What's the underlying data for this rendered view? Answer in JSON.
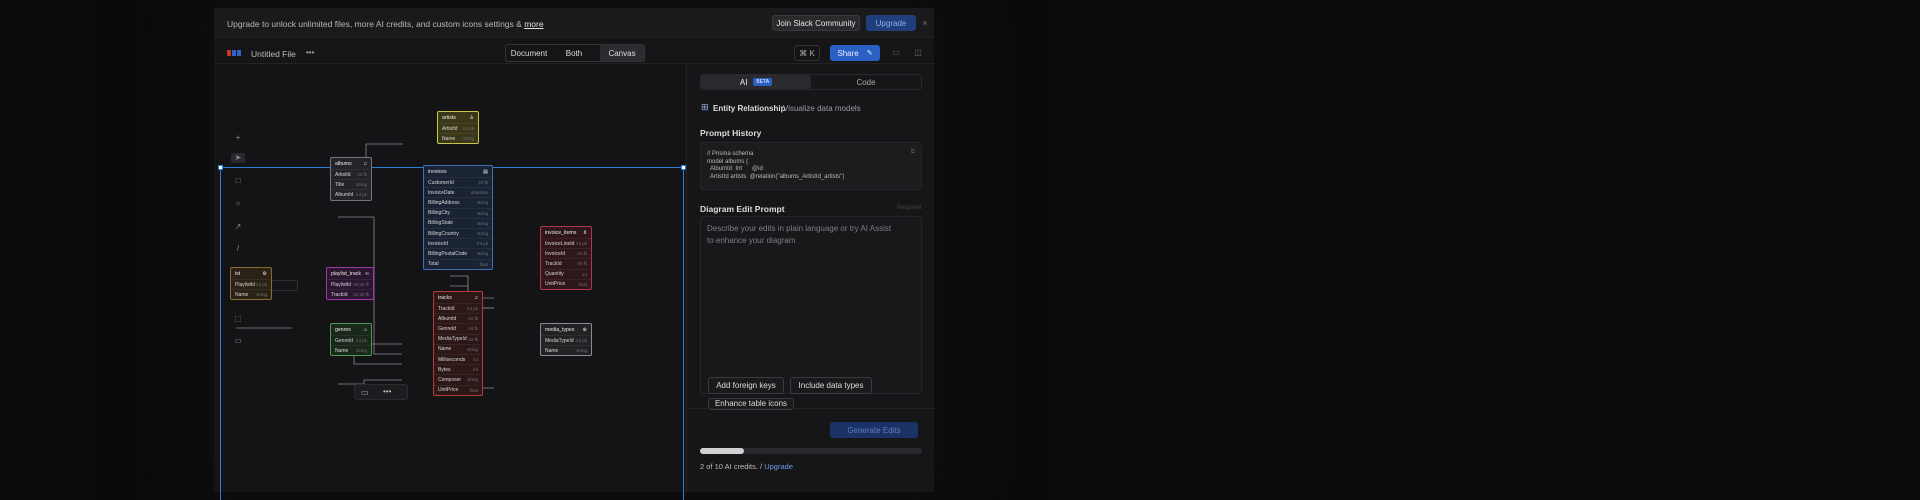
{
  "banner": {
    "message": "Upgrade to unlock unlimited files, more AI credits, and custom icons settings &",
    "link": "more",
    "join": "Join Slack Community",
    "upgrade": "Upgrade"
  },
  "toolbar": {
    "file_name": "Untitled File",
    "more": "•••",
    "views": [
      "Document",
      "Both",
      "Canvas"
    ],
    "shortcut": "⌘ K",
    "share": "Share"
  },
  "canvas": {
    "note_label": "Untitled ERD",
    "tables": [
      {
        "id": "artists",
        "name": "artists",
        "icon": "user-icon",
        "color": "#c8c64a",
        "fill": "#3a3818",
        "rows": [
          [
            "ArtistId",
            "int pk"
          ],
          [
            "Name",
            "string"
          ]
        ]
      },
      {
        "id": "albums",
        "name": "albums",
        "icon": "music-icon",
        "color": "#6f7682",
        "fill": "#222428",
        "rows": [
          [
            "ArtistId",
            "int fk"
          ],
          [
            "Title",
            "string"
          ],
          [
            "AlbumId",
            "int pk"
          ]
        ]
      },
      {
        "id": "invoices",
        "name": "invoices",
        "icon": "document-icon",
        "color": "#3f6fb8",
        "fill": "#1a2333",
        "rows": [
          [
            "CustomerId",
            "int fk"
          ],
          [
            "InvoiceDate",
            "datetime"
          ],
          [
            "BillingAddress",
            "string"
          ],
          [
            "BillingCity",
            "string"
          ],
          [
            "BillingState",
            "string"
          ],
          [
            "BillingCountry",
            "string"
          ],
          [
            "InvoiceId",
            "int pk"
          ],
          [
            "BillingPostalCode",
            "string"
          ],
          [
            "Total",
            "float"
          ]
        ]
      },
      {
        "id": "invoice_items",
        "name": "invoice_items",
        "icon": "cart-icon",
        "color": "#b3374a",
        "fill": "#2e161b",
        "rows": [
          [
            "InvoiceLineId",
            "int pk"
          ],
          [
            "InvoiceId",
            "int fk"
          ],
          [
            "TrackId",
            "int fk"
          ],
          [
            "Quantity",
            "int"
          ],
          [
            "UnitPrice",
            "float"
          ]
        ]
      },
      {
        "id": "ist",
        "name": "ist",
        "icon": "gear-icon",
        "color": "#8a6b32",
        "fill": "#2a2216",
        "rows": [
          [
            "PlaylistId",
            "int pk"
          ],
          [
            "Name",
            "string"
          ]
        ]
      },
      {
        "id": "playlist_track",
        "name": "playlist_track",
        "icon": "link-icon",
        "color": "#a036a8",
        "fill": "#2b1630",
        "rows": [
          [
            "PlaylistId",
            "int pk fk"
          ],
          [
            "TrackId",
            "int pk fk"
          ]
        ]
      },
      {
        "id": "tracks",
        "name": "tracks",
        "icon": "music-icon",
        "color": "#b33b3b",
        "fill": "#2d1717",
        "rows": [
          [
            "TrackId",
            "int pk"
          ],
          [
            "AlbumId",
            "int fk"
          ],
          [
            "GenreId",
            "int fk"
          ],
          [
            "MediaTypeId",
            "int fk"
          ],
          [
            "Name",
            "string"
          ],
          [
            "Milliseconds",
            "int"
          ],
          [
            "Bytes",
            "int"
          ],
          [
            "Composer",
            "string"
          ],
          [
            "UnitPrice",
            "float"
          ]
        ]
      },
      {
        "id": "genres",
        "name": "genres",
        "icon": "tag-icon",
        "color": "#4f9a4f",
        "fill": "#19281a",
        "rows": [
          [
            "GenreId",
            "int pk"
          ],
          [
            "Name",
            "string"
          ]
        ]
      },
      {
        "id": "media_types",
        "name": "media_types",
        "icon": "plus-circle-icon",
        "color": "#8a8a90",
        "fill": "#222225",
        "rows": [
          [
            "MediaTypeId",
            "int pk"
          ],
          [
            "Name",
            "string"
          ]
        ]
      }
    ]
  },
  "panel": {
    "tabs": [
      "AI",
      "Code"
    ],
    "beta": "BETA",
    "entity_title": "Entity Relationship",
    "entity_sub": "Visualize data models",
    "prompt_history": "Prompt History",
    "code_lines": [
      "// Prisma schema",
      "",
      "model albums {",
      "  AlbumId  Int      @id",
      "  ArtistId artists  @relation(\"albums_ArtistId_artists\")"
    ],
    "edit_title": "Diagram Edit Prompt",
    "required": "Required",
    "placeholder": "Describe your edits in plain language or try AI Assist to enhance your diagram",
    "chips": [
      "Add foreign keys",
      "Include data types",
      "Enhance table icons"
    ],
    "generate": "Generate Edits",
    "credits_text": "2 of 10 AI credits. /",
    "credits_link": "Upgrade",
    "credits_fraction": 0.2
  }
}
